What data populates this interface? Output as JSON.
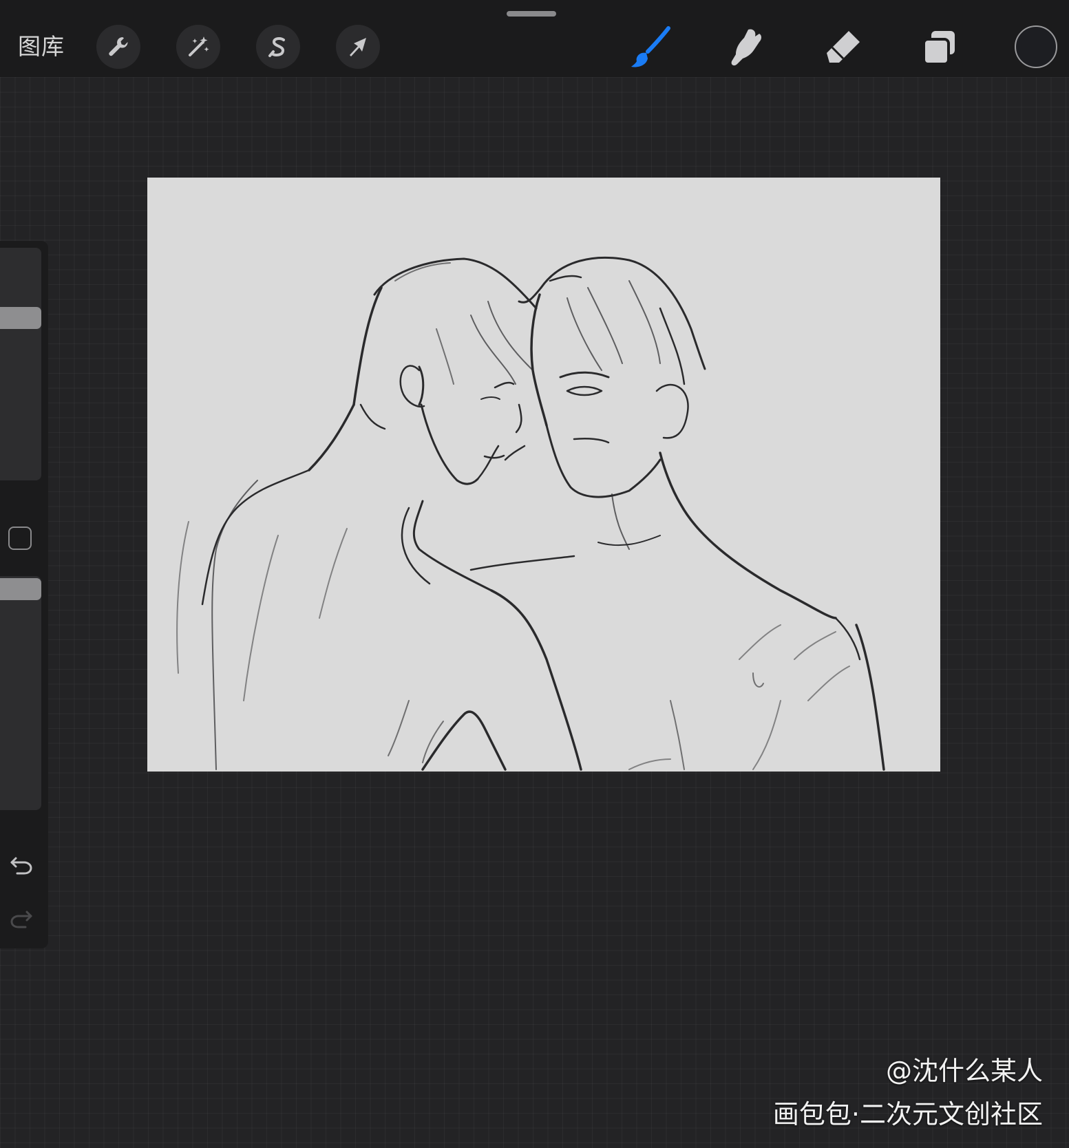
{
  "toolbar": {
    "gallery_label": "图库",
    "left_tools": [
      {
        "name": "actions",
        "icon": "wrench-icon"
      },
      {
        "name": "adjustments",
        "icon": "magic-wand-icon"
      },
      {
        "name": "selection",
        "icon": "selection-s-icon"
      },
      {
        "name": "transform",
        "icon": "arrow-cursor-icon"
      }
    ],
    "right_tools": [
      {
        "name": "brush",
        "icon": "brush-icon",
        "active": true
      },
      {
        "name": "smudge",
        "icon": "smudge-finger-icon",
        "active": false
      },
      {
        "name": "eraser",
        "icon": "eraser-icon",
        "active": false
      },
      {
        "name": "layers",
        "icon": "layers-icon",
        "active": false
      }
    ],
    "active_color": "#1d1e22",
    "accent_color": "#1a7cf5"
  },
  "sidebar": {
    "brush_size_level": 0.72,
    "opacity_level": 0.99,
    "modify_icon": "square-modify-icon",
    "undo_icon": "undo-icon",
    "redo_icon": "redo-icon",
    "redo_enabled": false
  },
  "canvas": {
    "background_color": "#dadada",
    "content": "pencil-sketch-two-figures"
  },
  "watermark": {
    "line1": "@沈什么某人",
    "line2": "画包包·二次元文创社区"
  }
}
